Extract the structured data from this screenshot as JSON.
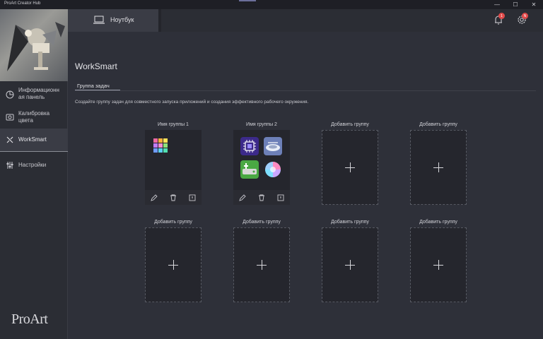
{
  "window": {
    "title": "ProArt Creator Hub",
    "minimize": "—",
    "maximize": "☐",
    "close": "✕"
  },
  "sidebar": {
    "items": [
      {
        "label": "Информационн ая панель",
        "icon": "dashboard-icon"
      },
      {
        "label": "Калибровка цвета",
        "icon": "calibration-icon"
      },
      {
        "label": "WorkSmart",
        "icon": "worksmart-icon"
      },
      {
        "label": "Настройки",
        "icon": "settings-sliders-icon"
      }
    ],
    "logo": "ProArt"
  },
  "header": {
    "device_tab": "Ноутбук",
    "notification_count": "1",
    "settings_badge": "N"
  },
  "main": {
    "title": "WorkSmart",
    "subtab": "Группа задач",
    "description": "Создайте группу задач для совместного запуска приложений и создания эффективного рабочего окружения."
  },
  "groups": [
    {
      "name": "Имя группы 1"
    },
    {
      "name": "Имя группы 2"
    },
    {
      "name": "Добавить группу"
    },
    {
      "name": "Добавить группу"
    },
    {
      "name": "Добавить группу"
    },
    {
      "name": "Добавить группу"
    },
    {
      "name": "Добавить группу"
    },
    {
      "name": "Добавить группу"
    }
  ],
  "colors": {
    "accent": "#9a9dab",
    "badge": "#e04a4a",
    "background": "#2e3039"
  }
}
